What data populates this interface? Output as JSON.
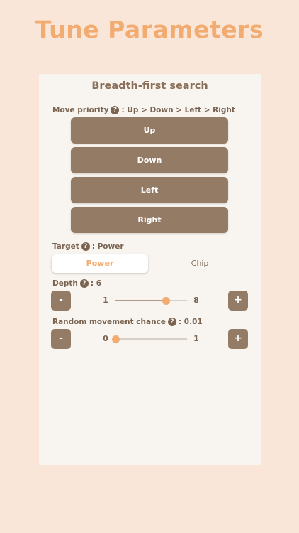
{
  "app": {
    "title": "Tune Parameters"
  },
  "panel": {
    "title": "Breadth-first search",
    "move_priority": {
      "label": "Move priority",
      "colon": ":",
      "value": "Up > Down > Left > Right",
      "buttons": [
        "Up",
        "Down",
        "Left",
        "Right"
      ]
    },
    "target": {
      "label": "Target",
      "colon": ":",
      "value": "Power",
      "options": [
        "Power",
        "Chip"
      ],
      "selected": "Power"
    },
    "depth": {
      "label": "Depth",
      "colon": ":",
      "value": "6",
      "min": "1",
      "max": "8",
      "level": 6,
      "minus": "-",
      "plus": "+"
    },
    "random": {
      "label": "Random movement chance",
      "colon": ":",
      "value": "0.01",
      "min": "0",
      "max": "1",
      "level": 0.01,
      "minus": "-",
      "plus": "+"
    }
  },
  "help_glyph": "?",
  "colors": {
    "accent": "#f2ab70",
    "button": "#937b66",
    "background": "#fae6d8",
    "panel": "#f8f5f0"
  }
}
